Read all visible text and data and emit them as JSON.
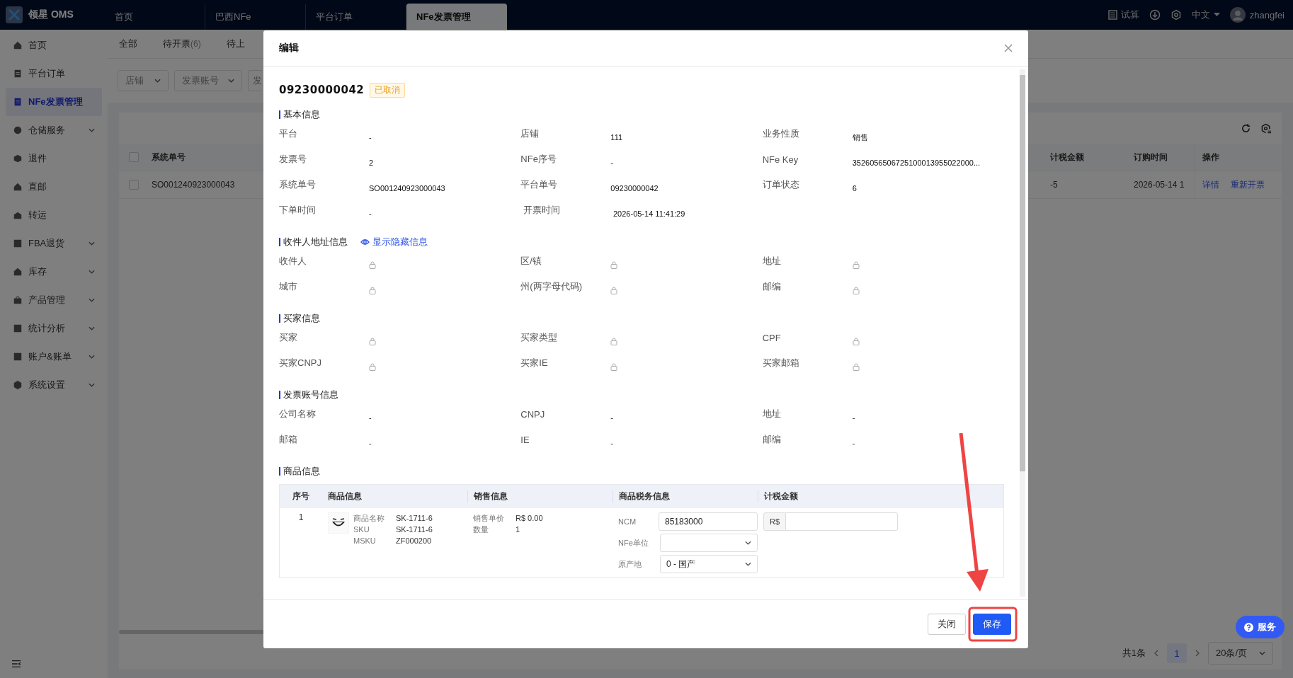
{
  "topbar": {
    "logo": "领星 OMS",
    "tabs": [
      {
        "label": "首页",
        "selected": false
      },
      {
        "label": "巴西NFe",
        "selected": false
      },
      {
        "label": "平台订单",
        "selected": false
      },
      {
        "label": "NFe发票管理",
        "selected": true
      }
    ],
    "calc": "试算",
    "language": "中文",
    "user": "zhangfei"
  },
  "sidebar": {
    "items": [
      {
        "label": "首页",
        "selected": false,
        "expandable": false
      },
      {
        "label": "平台订单",
        "selected": false,
        "expandable": false
      },
      {
        "label": "NFe发票管理",
        "selected": true,
        "expandable": false
      },
      {
        "label": "仓储服务",
        "selected": false,
        "expandable": true
      },
      {
        "label": "退件",
        "selected": false,
        "expandable": false
      },
      {
        "label": "直邮",
        "selected": false,
        "expandable": false
      },
      {
        "label": "转运",
        "selected": false,
        "expandable": false
      },
      {
        "label": "FBA退货",
        "selected": false,
        "expandable": true
      },
      {
        "label": "库存",
        "selected": false,
        "expandable": true
      },
      {
        "label": "产品管理",
        "selected": false,
        "expandable": true
      },
      {
        "label": "统计分析",
        "selected": false,
        "expandable": true
      },
      {
        "label": "账户&账单",
        "selected": false,
        "expandable": true
      },
      {
        "label": "系统设置",
        "selected": false,
        "expandable": true
      }
    ]
  },
  "main": {
    "tabs": [
      {
        "label": "全部"
      },
      {
        "label": "待开票",
        "count": "(6)"
      },
      {
        "label": "待上"
      }
    ],
    "filters": [
      "店铺",
      "发票账号",
      "发"
    ],
    "table": {
      "all_checked": false,
      "left_columns": [
        "系统单号"
      ],
      "right_columns": [
        "计税金额",
        "订购时间",
        "操作"
      ],
      "rows": [
        {
          "checked": false,
          "system_no": "SO001240923000043",
          "tax_amount": "-5",
          "order_time": "2026-05-14 1",
          "actions": [
            "详情",
            "重新开票"
          ]
        }
      ]
    },
    "pagination": {
      "total": "共1条",
      "pages": [
        {
          "label": "1",
          "selected": true
        }
      ],
      "page_size": "20条/页"
    },
    "service": "服务"
  },
  "modal": {
    "title": "编辑",
    "order_no": "09230000042",
    "status": "已取消",
    "sections": [
      {
        "title": "基本信息",
        "fields": [
          {
            "label": "平台",
            "locked": false,
            "value": "-"
          },
          {
            "label": "店铺",
            "locked": false,
            "value": "111"
          },
          {
            "label": "业务性质",
            "locked": false,
            "value": "销售"
          },
          {
            "label": "发票号",
            "locked": false,
            "value": "2"
          },
          {
            "label": "NFe序号",
            "locked": false,
            "value": "-"
          },
          {
            "label": "NFe Key",
            "locked": false,
            "value": "3526056506725100013955022000..."
          },
          {
            "label": "系统单号",
            "locked": false,
            "value": "SO001240923000043"
          },
          {
            "label": "平台单号",
            "locked": false,
            "value": "09230000042"
          },
          {
            "label": "订单状态",
            "locked": false,
            "value": "6"
          },
          {
            "label": "下单时间",
            "locked": false,
            "value": "-"
          },
          {
            "label": "开票时间",
            "locked": false,
            "value": "2026-05-14 11:41:29"
          }
        ]
      },
      {
        "title": "收件人地址信息",
        "link": "显示隐藏信息",
        "fields": [
          {
            "label": "收件人",
            "locked": true
          },
          {
            "label": "区/镇",
            "locked": true
          },
          {
            "label": "地址",
            "locked": true
          },
          {
            "label": "城市",
            "locked": true
          },
          {
            "label": "州(两字母代码)",
            "locked": true
          },
          {
            "label": "邮编",
            "locked": true
          }
        ]
      },
      {
        "title": "买家信息",
        "fields": [
          {
            "label": "买家",
            "locked": true
          },
          {
            "label": "买家类型",
            "locked": true
          },
          {
            "label": "CPF",
            "locked": true
          },
          {
            "label": "买家CNPJ",
            "locked": true
          },
          {
            "label": "买家IE",
            "locked": true
          },
          {
            "label": "买家邮箱",
            "locked": true
          }
        ]
      },
      {
        "title": "发票账号信息",
        "fields": [
          {
            "label": "公司名称",
            "locked": false,
            "value": "-"
          },
          {
            "label": "CNPJ",
            "locked": false,
            "value": "-"
          },
          {
            "label": "地址",
            "locked": false,
            "value": "-"
          },
          {
            "label": "邮箱",
            "locked": false,
            "value": "-"
          },
          {
            "label": "IE",
            "locked": false,
            "value": "-"
          },
          {
            "label": "邮编",
            "locked": false,
            "value": "-"
          }
        ]
      }
    ],
    "products": {
      "title": "商品信息",
      "columns": [
        "序号",
        "商品信息",
        "销售信息",
        "商品税务信息",
        "计税金额"
      ],
      "rows": [
        {
          "index": "1",
          "info": [
            {
              "label": "商品名称",
              "value": "SK-1711-6"
            },
            {
              "label": "SKU",
              "value": "SK-1711-6"
            },
            {
              "label": "MSKU",
              "value": "ZF000200"
            }
          ],
          "sales": [
            {
              "label": "销售单价",
              "value": "R$ 0.00"
            },
            {
              "label": "数量",
              "value": "1"
            }
          ],
          "tax": [
            {
              "label": "NCM",
              "kind": "input",
              "value": "85183000"
            },
            {
              "label": "NFe单位",
              "kind": "select"
            },
            {
              "label": "原产地",
              "kind": "select",
              "value": "0 - 国产"
            }
          ],
          "amount_prefix": "R$"
        }
      ]
    },
    "buttons": [
      {
        "label": "关闭",
        "kind": "default"
      },
      {
        "label": "保存",
        "kind": "primary"
      }
    ]
  },
  "annotations": {
    "arrow_to_save": true,
    "save_highlighted": true
  }
}
